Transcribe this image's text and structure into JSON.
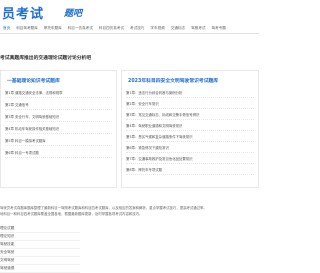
{
  "header": {
    "logo_text": "员考试",
    "logo_sub": "题吧"
  },
  "nav": {
    "items": [
      "首页",
      "科目驾考题库",
      "摩托车题库",
      "科目一仿真考试",
      "科目四仿真考试",
      "考试技巧",
      "学车视频",
      "交通标志",
      "驾照考试",
      "驾考专题"
    ]
  },
  "page": {
    "title": "考试真题库推出的交通理论试题讨论分析吧"
  },
  "left_panel": {
    "title": "一基础理论知识考试题库",
    "items": [
      "第1章 道路交通安全法律、法规和规章",
      "第2章 交通信号",
      "第3章 安全行车、文明驾驶基础知识",
      "第4章 机动车驾驶操作相关基础知识",
      "第5章 科目一模拟考试题库",
      "第6章 科目一专项试题"
    ]
  },
  "right_panel": {
    "title": "2023年科目四安全文明驾驶常识考试题库",
    "items": [
      "第1章：违法行为综合判断与案例分析",
      "第2章：安全行车常识",
      "第3章：常见交通标志、标线和交警手势信号辨识",
      "第4章：驾驶职业道德和文明驾驶常识",
      "第5章：恶劣气候和复杂道路条件下驾驶常识",
      "第6章：紧急情况下避险常识",
      "第7章：交通事故救护及常见危化品处置常识",
      "第8章：摩托车专项试题"
    ]
  },
  "intro": {
    "lines": [
      "驾驶员考试真题库题库整理了最新科目一驾照考试题库和科目四考试题库，以及相应的答案和解析，重点掌握考试技巧，提高考试通过率。",
      "地科目一和科目四考试题库覆盖全国各地，根据最新题库更新，及时掌握各项考试内容和技巧。"
    ]
  },
  "list": {
    "items": [
      "理论试题",
      "理论知识",
      "驾驶技能",
      "安全驾驶",
      "文明驾驶",
      "驾驶道德"
    ]
  }
}
